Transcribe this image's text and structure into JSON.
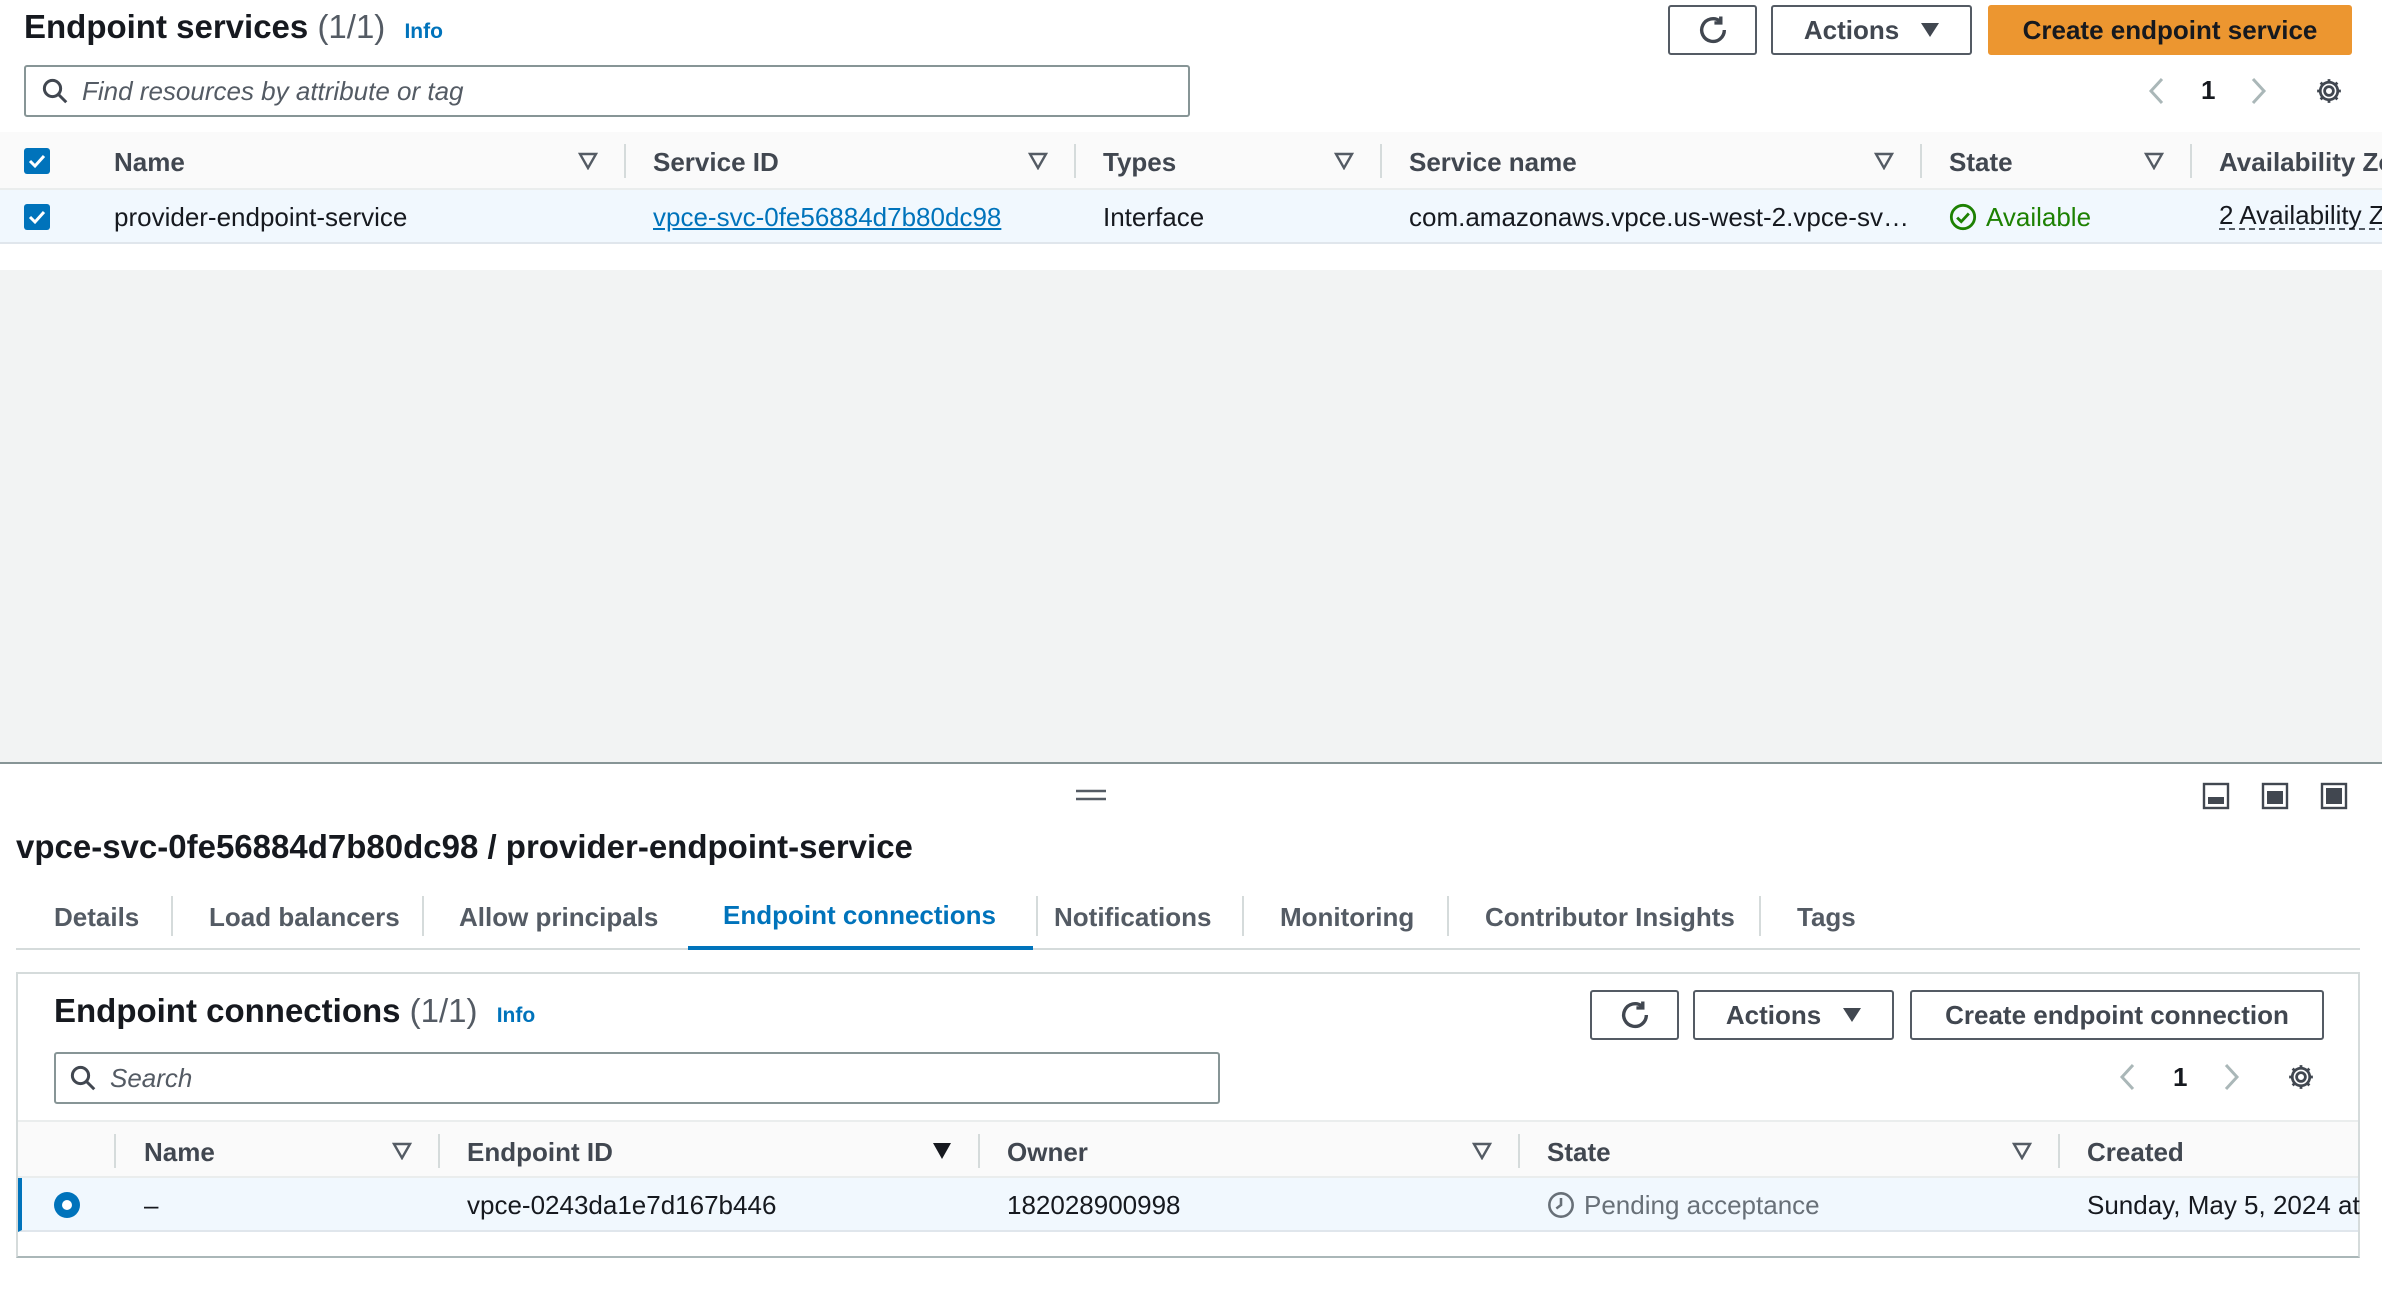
{
  "top": {
    "title": "Endpoint services",
    "count": "(1/1)",
    "info": "Info",
    "actions_label": "Actions",
    "create_label": "Create endpoint service",
    "search_placeholder": "Find resources by attribute or tag",
    "page": "1",
    "columns": [
      "Name",
      "Service ID",
      "Types",
      "Service name",
      "State",
      "Availability Zo"
    ],
    "row": {
      "name": "provider-endpoint-service",
      "service_id": "vpce-svc-0fe56884d7b80dc98",
      "type": "Interface",
      "service_name": "com.amazonaws.vpce.us-west-2.vpce-sv…",
      "state": "Available",
      "availability": "2 Availability Z"
    }
  },
  "detail": {
    "title": "vpce-svc-0fe56884d7b80dc98 / provider-endpoint-service",
    "tabs": [
      "Details",
      "Load balancers",
      "Allow principals",
      "Endpoint connections",
      "Notifications",
      "Monitoring",
      "Contributor Insights",
      "Tags"
    ],
    "active_tab": "Endpoint connections"
  },
  "connections": {
    "title": "Endpoint connections",
    "count": "(1/1)",
    "info": "Info",
    "actions_label": "Actions",
    "create_label": "Create endpoint connection",
    "search_placeholder": "Search",
    "page": "1",
    "columns": [
      "Name",
      "Endpoint ID",
      "Owner",
      "State",
      "Created"
    ],
    "row": {
      "name": "–",
      "endpoint_id": "vpce-0243da1e7d167b446",
      "owner": "182028900998",
      "state": "Pending acceptance",
      "created": "Sunday, May 5, 2024 at"
    }
  },
  "colors": {
    "primary": "#ec9630",
    "link": "#0073bb",
    "success": "#1d8102",
    "pending": "#687078"
  }
}
